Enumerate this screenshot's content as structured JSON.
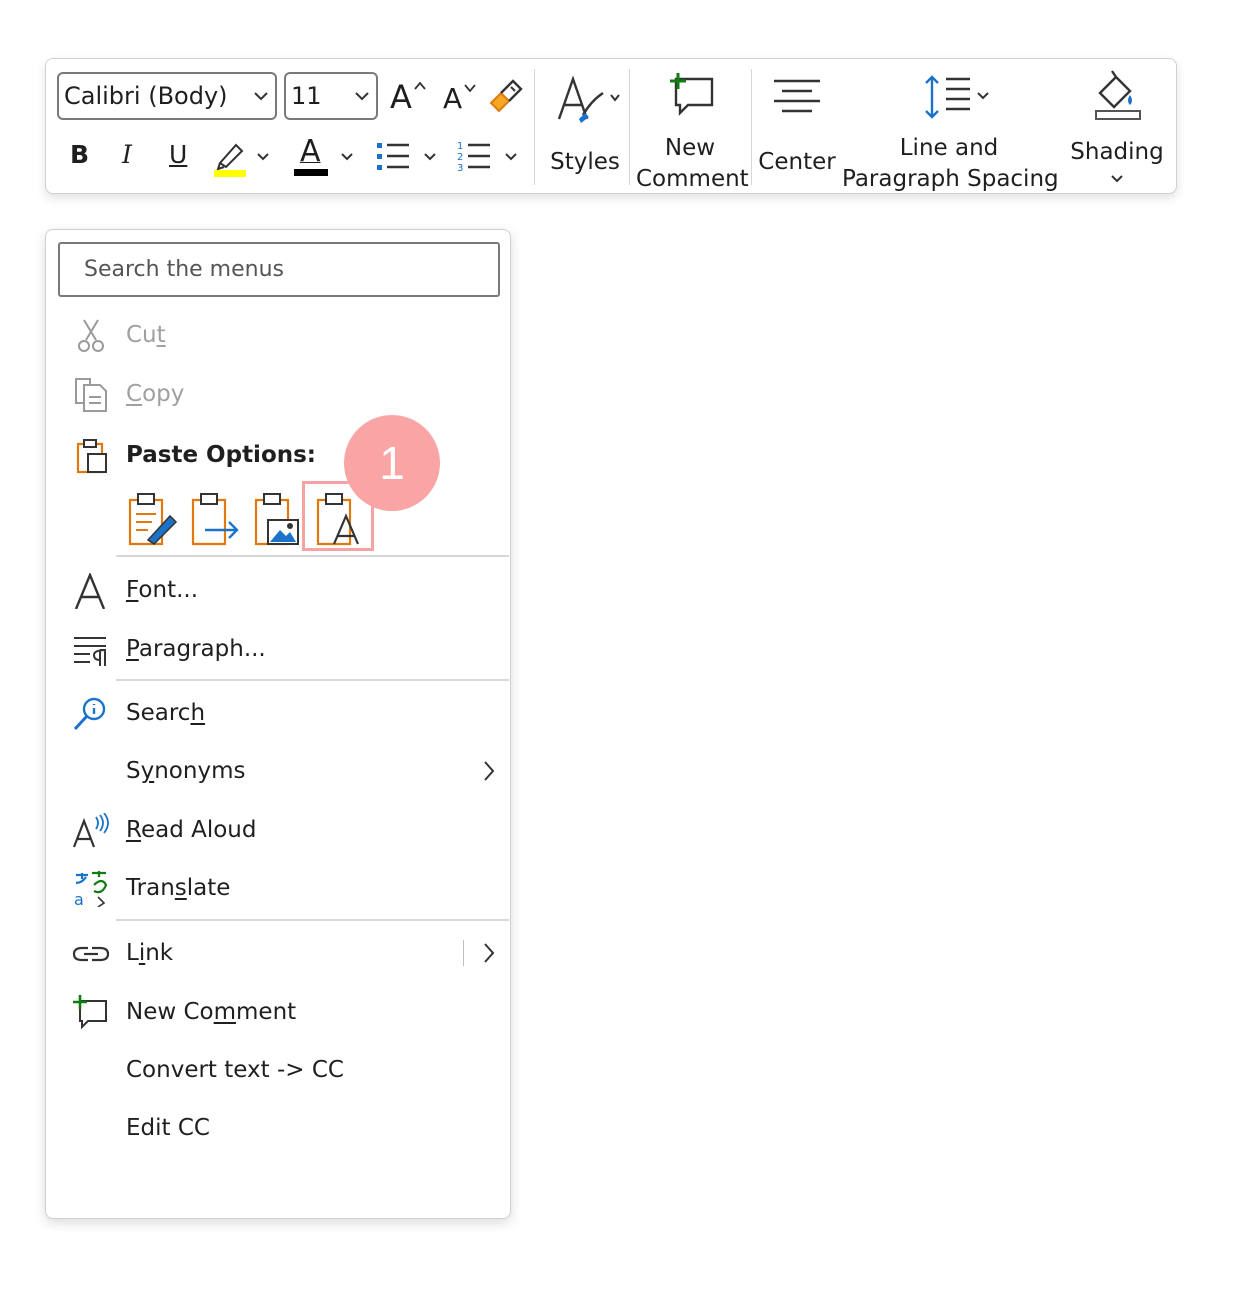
{
  "toolbar": {
    "font_name": "Calibri (Body)",
    "font_size": "11",
    "grow_font": "A",
    "shrink_font": "A",
    "bold": "B",
    "italic": "I",
    "underline": "U",
    "font_color_letter": "A",
    "styles_label": "Styles",
    "new_comment_line1": "New",
    "new_comment_line2": "Comment",
    "center_label": "Center",
    "line_spacing_line1": "Line and",
    "line_spacing_line2": "Paragraph Spacing",
    "shading_label": "Shading",
    "highlight_color": "#ffff00",
    "font_color": "#000000",
    "accent_blue": "#1a73c9",
    "accent_green": "#107c10",
    "accent_orange": "#e07a10"
  },
  "menu": {
    "search_placeholder": "Search the menus",
    "cut": {
      "pre": "Cu",
      "mn": "t",
      "post": ""
    },
    "copy": {
      "pre": "",
      "mn": "C",
      "post": "opy"
    },
    "paste_options_label": "Paste Options:",
    "font": {
      "pre": "",
      "mn": "F",
      "post": "ont..."
    },
    "paragraph": {
      "pre": "",
      "mn": "P",
      "post": "aragraph..."
    },
    "search": {
      "pre": "Searc",
      "mn": "h",
      "post": ""
    },
    "synonyms": {
      "pre": "S",
      "mn": "y",
      "post": "nonyms"
    },
    "read_aloud": {
      "pre": "",
      "mn": "R",
      "post": "ead Aloud"
    },
    "translate": {
      "pre": "Tran",
      "mn": "s",
      "post": "late"
    },
    "link": {
      "pre": "L",
      "mn": "i",
      "post": "nk"
    },
    "new_comment": {
      "pre": "New Co",
      "mn": "m",
      "post": "ment"
    },
    "convert_text": "Convert text -> CC",
    "edit_cc": "Edit CC"
  },
  "annotation": {
    "badge_number": "1",
    "badge_color": "#f9a5a5"
  }
}
